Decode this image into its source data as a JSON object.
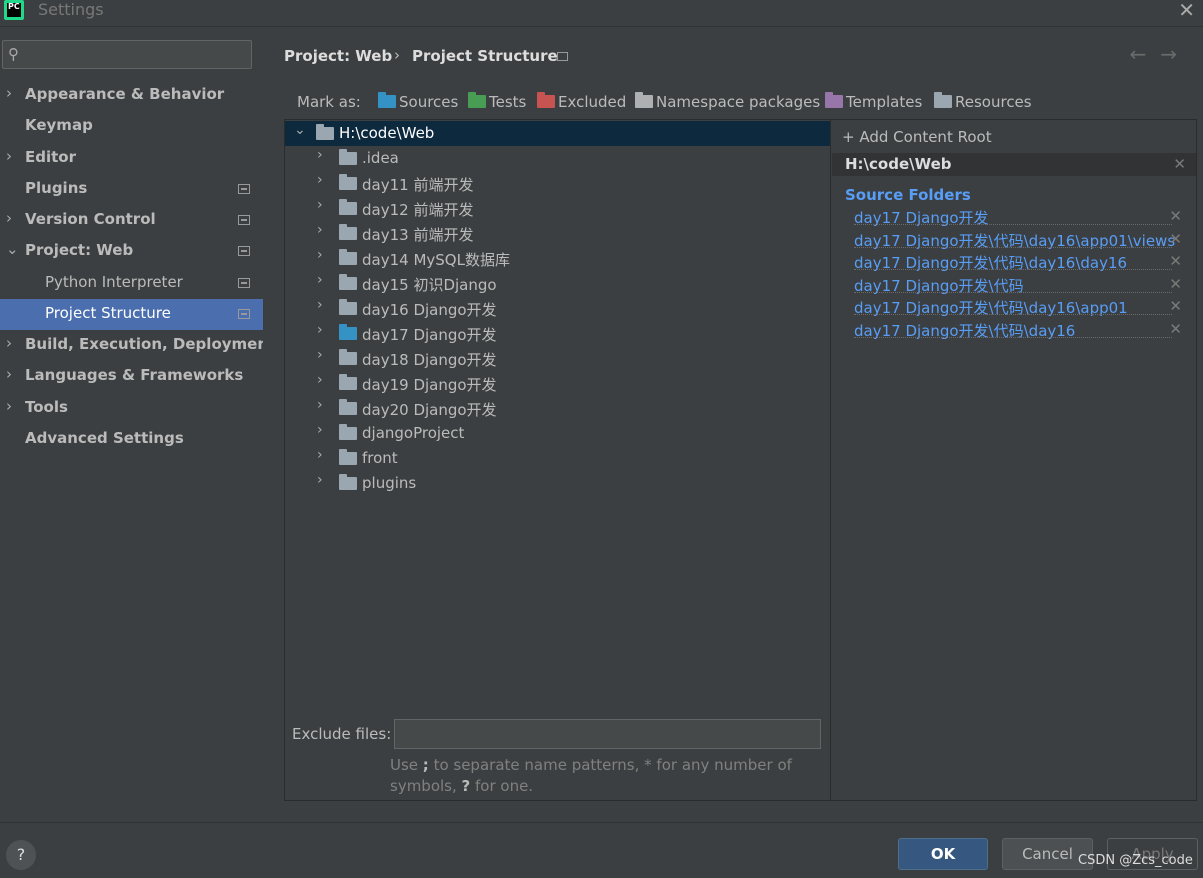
{
  "window": {
    "title": "Settings",
    "logo_text": "PC"
  },
  "search": {
    "placeholder": ""
  },
  "sidebar": {
    "items": [
      {
        "label": "Appearance & Behavior",
        "chevron": "›",
        "sub": false
      },
      {
        "label": "Keymap",
        "chevron": "",
        "sub": false
      },
      {
        "label": "Editor",
        "chevron": "›",
        "sub": false
      },
      {
        "label": "Plugins",
        "chevron": "",
        "sub": false
      },
      {
        "label": "Version Control",
        "chevron": "›",
        "sub": false
      },
      {
        "label": "Project: Web",
        "chevron": "⌄",
        "sub": false
      },
      {
        "label": "Python Interpreter",
        "chevron": "",
        "sub": true
      },
      {
        "label": "Project Structure",
        "chevron": "",
        "sub": true,
        "selected": true
      },
      {
        "label": "Build, Execution, Deployment",
        "chevron": "›",
        "sub": false
      },
      {
        "label": "Languages & Frameworks",
        "chevron": "›",
        "sub": false
      },
      {
        "label": "Tools",
        "chevron": "›",
        "sub": false
      },
      {
        "label": "Advanced Settings",
        "chevron": "",
        "sub": false
      }
    ]
  },
  "breadcrumb": {
    "project": "Project: Web",
    "separator": "›",
    "page": "Project Structure",
    "nav": "←→"
  },
  "markas": {
    "label": "Mark as:",
    "buttons": [
      {
        "label": "Sources",
        "color": "#3592c4"
      },
      {
        "label": "Tests",
        "color": "#499c54"
      },
      {
        "label": "Excluded",
        "color": "#c75450"
      },
      {
        "label": "Namespace packages",
        "color": "#aeb0b2"
      },
      {
        "label": "Templates",
        "color": "#9876aa"
      },
      {
        "label": "Resources",
        "color": "#9aa7b0"
      }
    ]
  },
  "tree": {
    "root": {
      "label": "H:\\code\\Web",
      "chevron": "⌄"
    },
    "children": [
      {
        "label": ".idea",
        "color": "#9aa7b0"
      },
      {
        "label": "day11 前端开发",
        "color": "#9aa7b0"
      },
      {
        "label": "day12 前端开发",
        "color": "#9aa7b0"
      },
      {
        "label": "day13 前端开发",
        "color": "#9aa7b0"
      },
      {
        "label": "day14 MySQL数据库",
        "color": "#9aa7b0"
      },
      {
        "label": "day15 初识Django",
        "color": "#9aa7b0"
      },
      {
        "label": "day16 Django开发",
        "color": "#9aa7b0"
      },
      {
        "label": "day17 Django开发",
        "color": "#3592c4"
      },
      {
        "label": "day18 Django开发",
        "color": "#9aa7b0"
      },
      {
        "label": "day19 Django开发",
        "color": "#9aa7b0"
      },
      {
        "label": "day20 Django开发",
        "color": "#9aa7b0"
      },
      {
        "label": "djangoProject",
        "color": "#9aa7b0"
      },
      {
        "label": "front",
        "color": "#9aa7b0"
      },
      {
        "label": "plugins",
        "color": "#9aa7b0"
      }
    ]
  },
  "exclude": {
    "label": "Exclude files:",
    "value": "",
    "hint_pre": "Use ",
    "hint_sep": ";",
    "hint_mid": " to separate name patterns, * for any number of symbols, ",
    "hint_q": "?",
    "hint_post": " for one."
  },
  "roots": {
    "add_label": "Add Content Root",
    "add_icon": "+",
    "root_label": "H:\\code\\Web",
    "close_glyph": "✕",
    "source_title": "Source Folders",
    "source_folders": [
      "day17 Django开发",
      "day17 Django开发\\代码\\day16\\app01\\views",
      "day17 Django开发\\代码\\day16\\day16",
      "day17 Django开发\\代码",
      "day17 Django开发\\代码\\day16\\app01",
      "day17 Django开发\\代码\\day16"
    ]
  },
  "footer": {
    "help": "?",
    "ok": "OK",
    "cancel": "Cancel",
    "apply": "Apply",
    "watermark": "CSDN @Zcs_code"
  }
}
